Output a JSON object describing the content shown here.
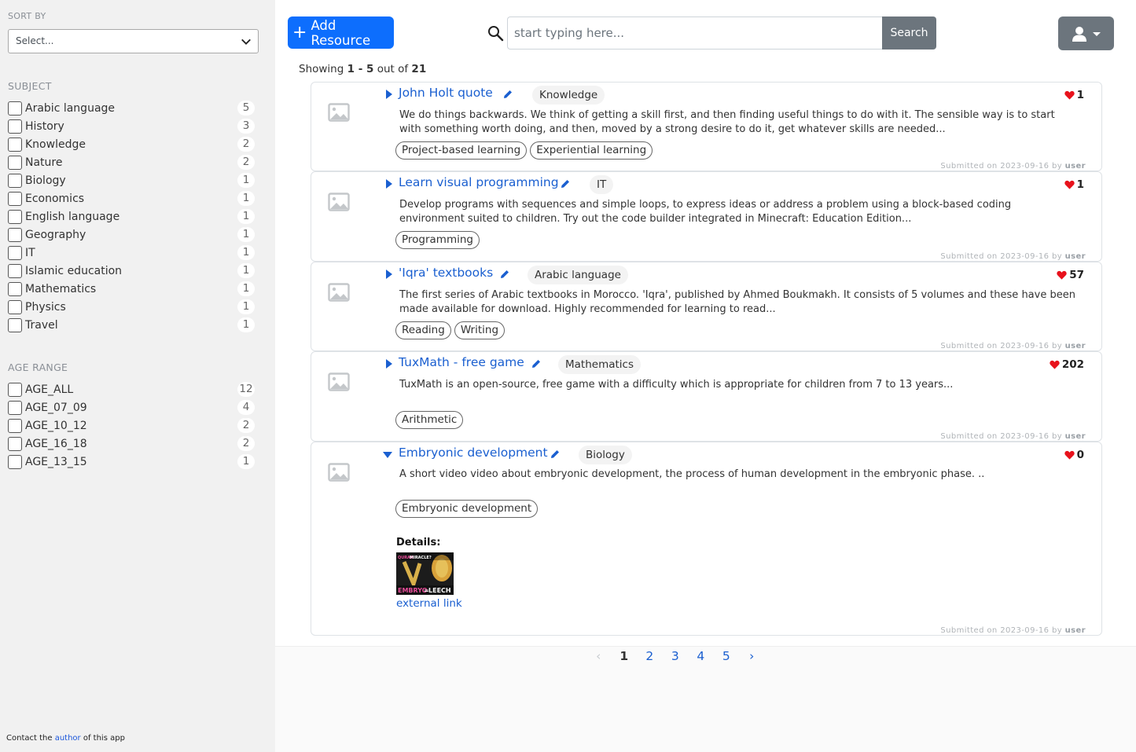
{
  "sidebar": {
    "sort": {
      "heading": "SORT BY",
      "selected": "Select..."
    },
    "subject": {
      "heading": "SUBJECT",
      "items": [
        {
          "label": "Arabic language",
          "count": "5"
        },
        {
          "label": "History",
          "count": "3"
        },
        {
          "label": "Knowledge",
          "count": "2"
        },
        {
          "label": "Nature",
          "count": "2"
        },
        {
          "label": "Biology",
          "count": "1"
        },
        {
          "label": "Economics",
          "count": "1"
        },
        {
          "label": "English language",
          "count": "1"
        },
        {
          "label": "Geography",
          "count": "1"
        },
        {
          "label": "IT",
          "count": "1"
        },
        {
          "label": "Islamic education",
          "count": "1"
        },
        {
          "label": "Mathematics",
          "count": "1"
        },
        {
          "label": "Physics",
          "count": "1"
        },
        {
          "label": "Travel",
          "count": "1"
        }
      ]
    },
    "age": {
      "heading": "AGE RANGE",
      "items": [
        {
          "label": "AGE_ALL",
          "count": "12"
        },
        {
          "label": "AGE_07_09",
          "count": "4"
        },
        {
          "label": "AGE_10_12",
          "count": "2"
        },
        {
          "label": "AGE_16_18",
          "count": "2"
        },
        {
          "label": "AGE_13_15",
          "count": "1"
        }
      ]
    },
    "footer": {
      "prefix": "Contact the",
      "link": "author",
      "suffix": "of this app"
    }
  },
  "header": {
    "add_label": "Add Resource",
    "search_placeholder": "start typing here...",
    "search_button": "Search"
  },
  "results": {
    "prefix": "Showing",
    "range": "1 - 5",
    "middle": "out of",
    "total": "21"
  },
  "cards": [
    {
      "title": "John Holt quote",
      "subject": "Knowledge",
      "likes": "1",
      "description": "We do things backwards. We think of getting a skill first, and then finding useful things to do with it. The sensible way is to start with something worth doing, and then, moved by a strong desire to do it, get whatever skills are needed...",
      "tags": [
        "Project-based learning",
        "Experiential learning"
      ],
      "submitted_prefix": "Submitted on 2023-09-16 by",
      "submitted_by": "user"
    },
    {
      "title": "Learn visual programming",
      "subject": "IT",
      "likes": "1",
      "description": "Develop programs with sequences and simple loops, to express ideas or address a problem using a block-based coding environment suited to children. Try out the code builder integrated in Minecraft: Education Edition...",
      "tags": [
        "Programming"
      ],
      "submitted_prefix": "Submitted on 2023-09-16 by",
      "submitted_by": "user"
    },
    {
      "title": "'Iqra' textbooks",
      "subject": "Arabic language",
      "likes": "57",
      "description": "The first series of Arabic textbooks in Morocco. 'Iqra', published by Ahmed Boukmakh. It consists of 5 volumes and these have been made available for download. Highly recommended for learning to read...",
      "tags": [
        "Reading",
        "Writing"
      ],
      "submitted_prefix": "Submitted on 2023-09-16 by",
      "submitted_by": "user"
    },
    {
      "title": "TuxMath - free game",
      "subject": "Mathematics",
      "likes": "202",
      "description": "TuxMath is an open-source, free game with a difficulty which is appropriate for children from 7 to 13 years...",
      "tags": [
        "Arithmetic"
      ],
      "submitted_prefix": "Submitted on 2023-09-16 by",
      "submitted_by": "user"
    },
    {
      "title": "Embryonic development",
      "subject": "Biology",
      "likes": "0",
      "description": "A short video video about embryonic development, the process of human development in the embryonic phase. ..",
      "tags": [
        "Embryonic development"
      ],
      "details_label": "Details:",
      "thumbnail_text": {
        "top_left": "QURAN",
        "top_right": "MIRACLE?",
        "bottom_left": "EMBRYO",
        "bottom_eq": "=",
        "bottom_right": "LEECH"
      },
      "external_link": "external link",
      "submitted_prefix": "Submitted on 2023-09-16 by",
      "submitted_by": "user"
    }
  ],
  "pagination": {
    "prev": "‹",
    "pages": [
      "1",
      "2",
      "3",
      "4",
      "5"
    ],
    "next": "›",
    "current": "1"
  },
  "colors": {
    "primary": "#0d6efd",
    "secondary": "#6c757d",
    "heart": "#e8121c",
    "link": "#1a5fd0",
    "sidebar_bg": "#f1f1f1"
  },
  "icons": [
    "chevron-down-icon",
    "search-icon",
    "user-icon",
    "caret-down-icon",
    "image-placeholder-icon",
    "caret-right-icon",
    "pencil-icon",
    "heart-icon",
    "plus-icon"
  ]
}
